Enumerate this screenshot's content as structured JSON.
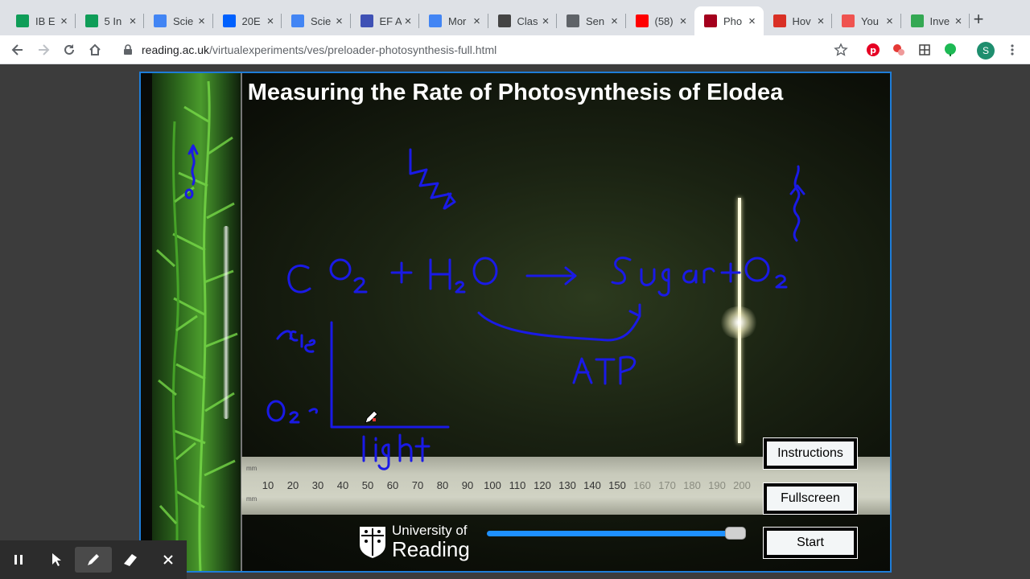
{
  "browser": {
    "tabs": [
      {
        "label": "IB E",
        "favicon": "sheets-icon",
        "color": "#0f9d58"
      },
      {
        "label": "5 In",
        "favicon": "sheets-icon",
        "color": "#0f9d58"
      },
      {
        "label": "Scie",
        "favicon": "docs-icon",
        "color": "#4285f4"
      },
      {
        "label": "20E",
        "favicon": "dropbox-icon",
        "color": "#0061fe"
      },
      {
        "label": "Scie",
        "favicon": "docs-icon",
        "color": "#4285f4"
      },
      {
        "label": "EF A",
        "favicon": "forms-icon",
        "color": "#3f51b5"
      },
      {
        "label": "Mor",
        "favicon": "docs-icon",
        "color": "#4285f4"
      },
      {
        "label": "Clas",
        "favicon": "classroom-icon",
        "color": "#444444"
      },
      {
        "label": "Sen",
        "favicon": "globe-icon",
        "color": "#5f6368"
      },
      {
        "label": "(58)",
        "favicon": "youtube-icon",
        "color": "#ff0000"
      },
      {
        "label": "Pho",
        "favicon": "reading-icon",
        "color": "#a4001d"
      },
      {
        "label": "Hov",
        "favicon": "news-icon",
        "color": "#d93025"
      },
      {
        "label": "You",
        "favicon": "edpuzzle-icon",
        "color": "#ef5350"
      },
      {
        "label": "Inve",
        "favicon": "leaf-icon",
        "color": "#34a853"
      }
    ],
    "active_tab": 10,
    "url_host": "reading.ac.uk",
    "url_path": "/virtualexperiments/ves/preloader-photosynthesis-full.html",
    "profile_initial": "S"
  },
  "experiment": {
    "title": "Measuring the Rate of Photosynthesis of Elodea",
    "ruler_unit": "mm",
    "ruler_ticks": [
      "10",
      "20",
      "30",
      "40",
      "50",
      "60",
      "70",
      "80",
      "90",
      "100",
      "110",
      "120",
      "130",
      "140",
      "150",
      "160",
      "170",
      "180",
      "190",
      "200"
    ],
    "logo_line1": "University of",
    "logo_line2": "Reading",
    "slider_value_percent": 100,
    "buttons": {
      "instructions": "Instructions",
      "fullscreen": "Fullscreen",
      "start": "Start"
    }
  },
  "annotations": {
    "ink_color": "#1a1ae6",
    "handwritten": [
      "CO₂ + H₂O → Sugar + O₂",
      "ATP",
      "rate",
      "O₂",
      "light"
    ]
  },
  "pen_toolbar": {
    "tools": [
      "pause-icon",
      "pointer-icon",
      "pen-icon",
      "eraser-icon",
      "close-icon"
    ],
    "selected": "pen-icon"
  }
}
